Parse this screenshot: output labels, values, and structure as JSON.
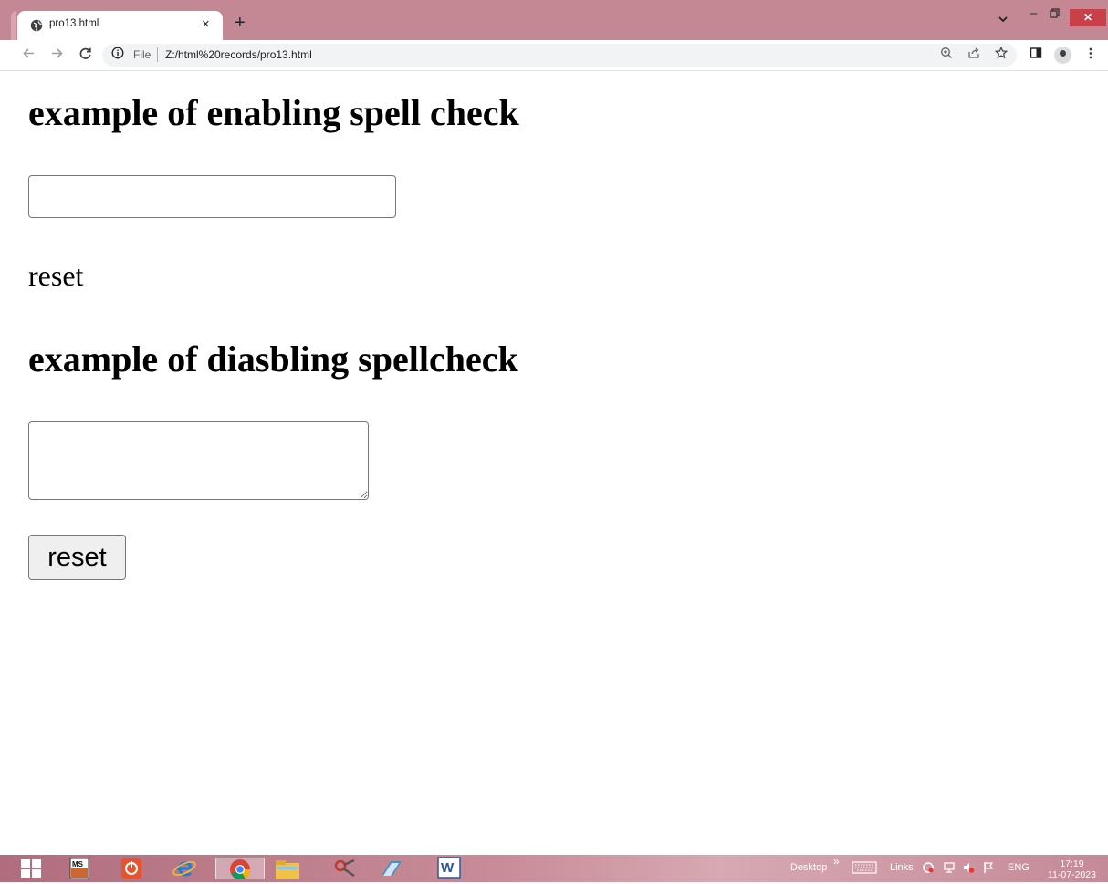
{
  "browser": {
    "tab_title": "pro13.html",
    "tab_close": "×",
    "new_tab": "+",
    "address": {
      "scheme_label": "File",
      "url": "Z:/html%20records/pro13.html"
    },
    "window_controls": {
      "minimize": "–",
      "restore": "🗗",
      "close": "✕"
    }
  },
  "page": {
    "heading1": "example of enabling spell check",
    "input1_value": "",
    "reset_text": "reset",
    "heading2": "example of diasbling spellcheck",
    "textarea_value": "",
    "reset_button": "reset"
  },
  "taskbar": {
    "tray": {
      "desktop": "Desktop",
      "links": "Links",
      "language": "ENG",
      "time": "17:19",
      "date": "11-07-2023"
    }
  },
  "icons": {
    "favicon": "globe-icon",
    "back": "arrow-left-icon",
    "forward": "arrow-right-icon",
    "reload": "reload-icon",
    "info": "info-icon",
    "zoom": "zoom-icon",
    "share": "share-icon",
    "bookmark": "star-icon",
    "sidepanel": "side-panel-icon",
    "profile": "profile-icon",
    "menu": "kebab-menu-icon"
  },
  "colors": {
    "titlebar": "#c48794",
    "close_button": "#c7404a",
    "page_background": "#ffffff"
  }
}
